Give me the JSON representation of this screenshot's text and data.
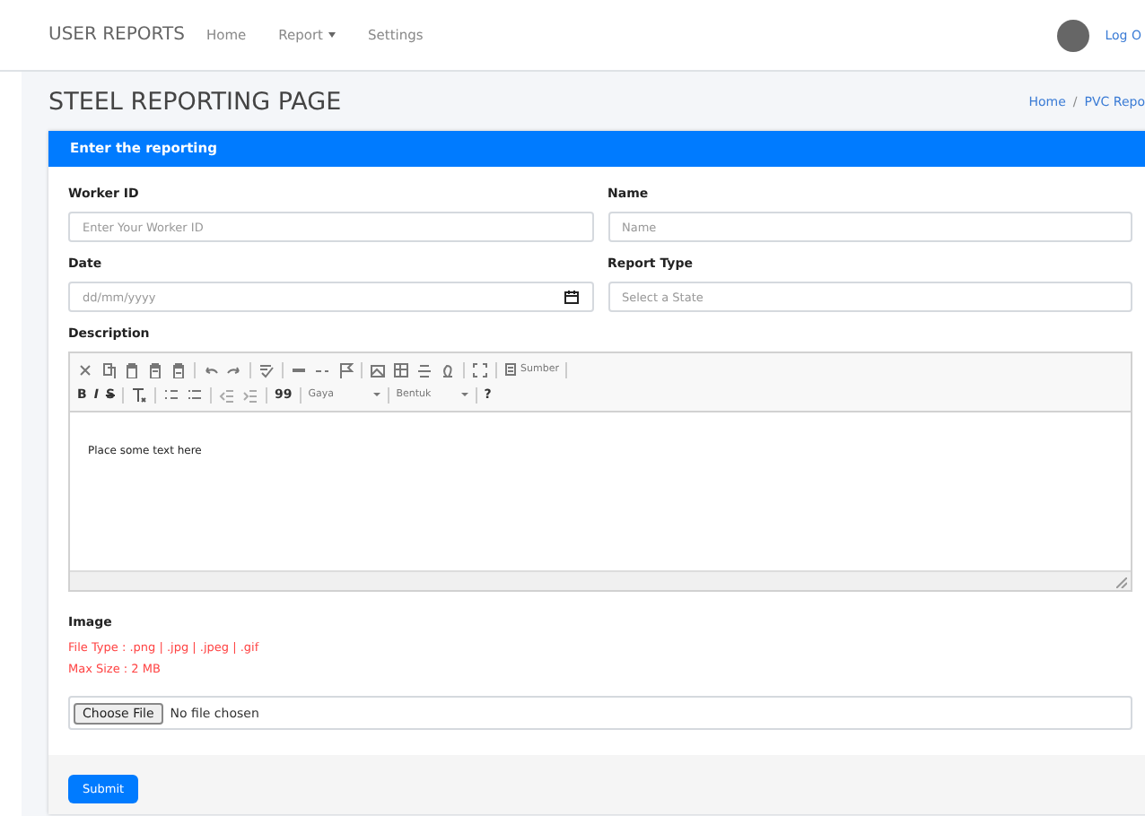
{
  "navbar": {
    "brand": "USER REPORTS",
    "links": [
      {
        "label": "Home",
        "dropdown": false
      },
      {
        "label": "Report",
        "dropdown": true
      },
      {
        "label": "Settings",
        "dropdown": false
      }
    ],
    "logout": "Log O"
  },
  "page": {
    "title": "STEEL REPORTING PAGE",
    "breadcrumb": [
      "Home",
      "PVC Repo"
    ],
    "separator": "/"
  },
  "card": {
    "header": "Enter the reporting",
    "fields": [
      {
        "label": "Worker ID",
        "kind": "text",
        "placeholder": "Enter Your Worker ID"
      },
      {
        "label": "Name",
        "kind": "text",
        "placeholder": "Name"
      },
      {
        "label": "Date",
        "kind": "date",
        "placeholder": "dd/mm/yyyy"
      },
      {
        "label": "Report Type",
        "kind": "select",
        "placeholder": "Select a State"
      }
    ],
    "description": {
      "label": "Description",
      "source": "Sumber",
      "bold": "B",
      "italic": "I",
      "strike": "S",
      "quote": "99",
      "style": "Gaya",
      "format": "Bentuk",
      "help": "?",
      "content": "Place some text here"
    },
    "image": {
      "label": "Image",
      "hints": [
        "File Type : .png | .jpg | .jpeg | .gif",
        "Max Size : 2 MB"
      ],
      "button": "Choose File",
      "status": "No file chosen"
    },
    "submit": "Submit"
  }
}
